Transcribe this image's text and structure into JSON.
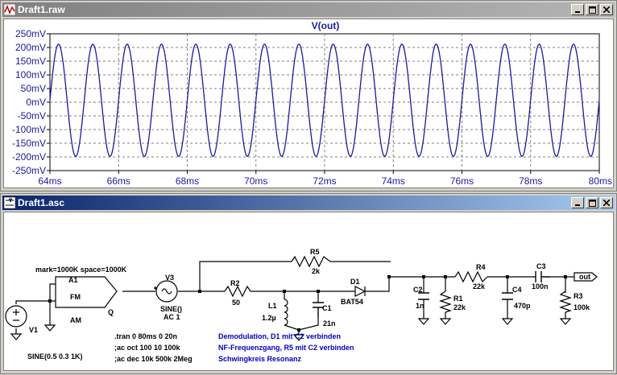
{
  "waveform_window": {
    "title": "Draft1.raw",
    "trace_name": "V(out)",
    "trace_color": "#1a1aa0"
  },
  "schematic_window": {
    "title": "Draft1.asc",
    "labels": {
      "a1_params": "mark=1000K space=1000K",
      "a1": "A1",
      "fm": "FM",
      "am": "AM",
      "q": "Q",
      "v1": "V1",
      "v1_value": "SINE(0.5 0.3 1K)",
      "v3": "V3",
      "v3_value": "SINE()",
      "v3_ac": "AC 1",
      "r2": "R2",
      "r2_value": "50",
      "r5": "R5",
      "r5_value": "2k",
      "l1": "L1",
      "l1_value": "1.2µ",
      "c1": "C1",
      "c1_value": "21n",
      "d1": "D1",
      "d1_value": "BAT54",
      "c2": "C2",
      "c2_value": "1n",
      "r1": "R1",
      "r1_value": "22k",
      "r4": "R4",
      "r4_value": "22k",
      "c4": "C4",
      "c4_value": "470p",
      "c3": "C3",
      "c3_value": "100n",
      "r3": "R3",
      "r3_value": "100k",
      "out": "out"
    },
    "directives": [
      ".tran 0 80ms 0 20n",
      ";ac oct 100 10 100k",
      ";ac dec 10k 500k 2Meg"
    ],
    "comments": [
      "Demodulation, D1 mit C2 verbinden",
      "NF-Frequenzgang, R5 mit C2 verbinden",
      "Schwingkreis Resonanz"
    ],
    "comment_color": "#0000c0"
  },
  "chart_data": {
    "type": "line",
    "title": "V(out)",
    "x_unit": "ms",
    "y_unit": "mV",
    "xlim": [
      64,
      80
    ],
    "ylim": [
      -250,
      250
    ],
    "x_ticks": [
      "64ms",
      "66ms",
      "68ms",
      "70ms",
      "72ms",
      "74ms",
      "76ms",
      "78ms",
      "80ms"
    ],
    "y_ticks": [
      "250mV",
      "200mV",
      "150mV",
      "100mV",
      "50mV",
      "0mV",
      "-50mV",
      "-100mV",
      "-150mV",
      "-200mV",
      "-250mV"
    ],
    "grid": true,
    "series": [
      {
        "name": "V(out)",
        "waveform": "sine",
        "amplitude_mV": 205,
        "offset_mV": 7,
        "period_ms": 1.0,
        "first_peak_ms": 64.25,
        "values_description_points": [
          [
            64.0,
            7
          ],
          [
            64.25,
            212
          ],
          [
            64.75,
            -198
          ],
          [
            65.25,
            212
          ],
          [
            65.75,
            -198
          ],
          [
            79.25,
            212
          ],
          [
            79.75,
            -198
          ],
          [
            80.0,
            7
          ]
        ]
      }
    ]
  }
}
